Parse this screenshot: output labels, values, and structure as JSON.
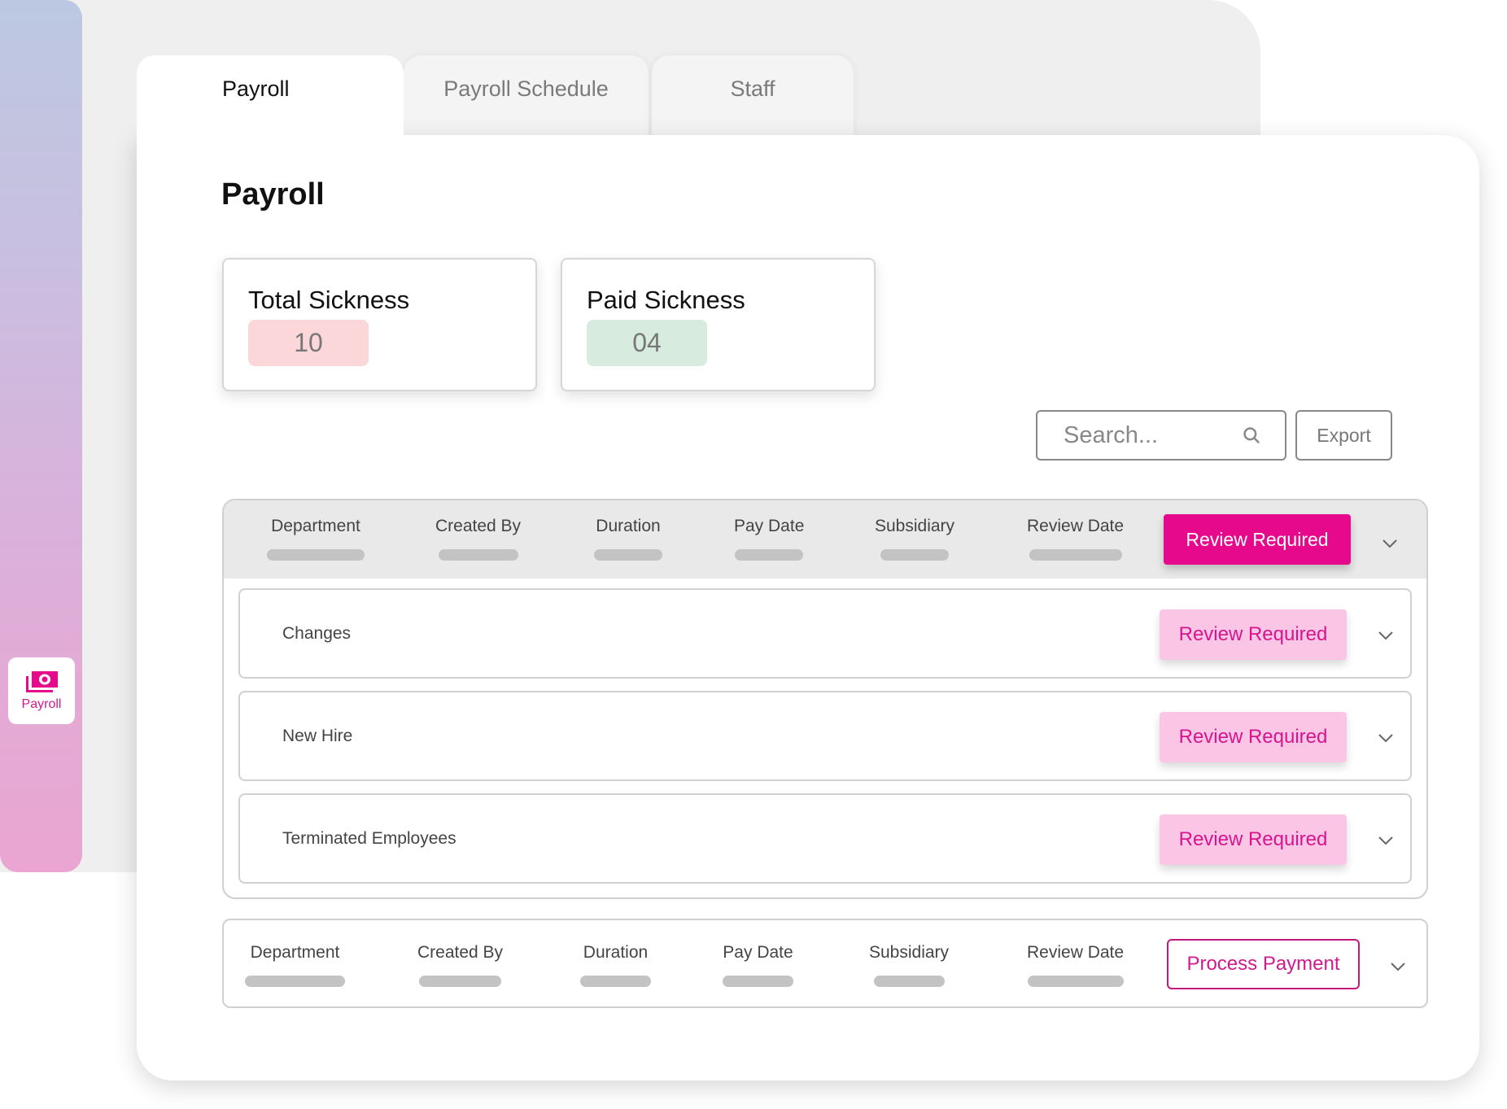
{
  "sidebar": {
    "items": [
      {
        "label": "Payroll",
        "icon": "money-icon",
        "active": true
      }
    ]
  },
  "tabs": [
    {
      "label": "Payroll",
      "active": true
    },
    {
      "label": "Payroll Schedule",
      "active": false
    },
    {
      "label": "Staff",
      "active": false
    }
  ],
  "page": {
    "title": "Payroll"
  },
  "stats": [
    {
      "title": "Total Sickness",
      "value": "10",
      "color": "#fcd7d9"
    },
    {
      "title": "Paid Sickness",
      "value": "04",
      "color": "#d7ecde"
    }
  ],
  "search": {
    "placeholder": "Search...",
    "value": ""
  },
  "toolbar": {
    "export_label": "Export"
  },
  "columns": [
    "Department",
    "Created By",
    "Duration",
    "Pay Date",
    "Subsidiary",
    "Review Date"
  ],
  "table1": {
    "action_label": "Review Required",
    "rows": [
      {
        "name": "Changes",
        "action_label": "Review Required"
      },
      {
        "name": "New Hire",
        "action_label": "Review Required"
      },
      {
        "name": "Terminated Employees",
        "action_label": "Review Required"
      }
    ]
  },
  "table2": {
    "action_label": "Process Payment"
  },
  "colors": {
    "accent": "#e6098b",
    "accent_soft": "#fbc6e6",
    "sidebar_top": "#bcc8e1",
    "sidebar_bottom": "#eaa5d2"
  }
}
